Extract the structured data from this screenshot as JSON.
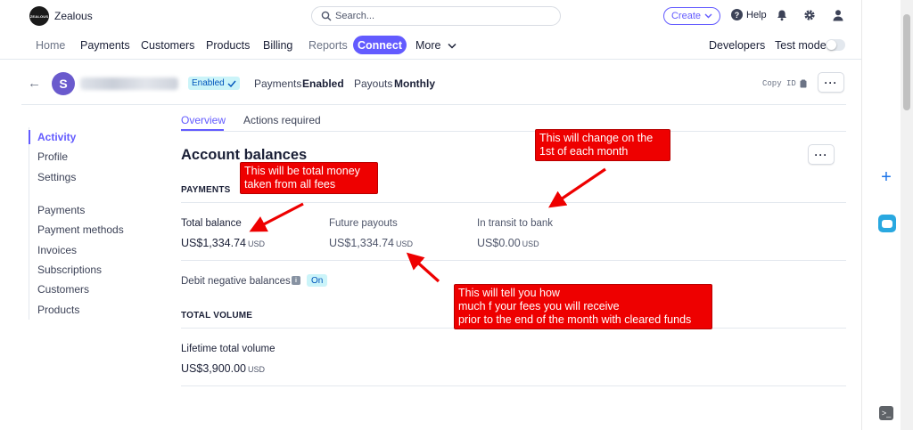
{
  "topbar": {
    "brand": "Zealous",
    "logo_text": "ZEALOUS",
    "search_placeholder": "Search...",
    "create_label": "Create",
    "help_label": "Help"
  },
  "nav": {
    "items": [
      "Home",
      "Payments",
      "Customers",
      "Products",
      "Billing",
      "Reports",
      "Connect",
      "More"
    ],
    "developers": "Developers",
    "test_mode": "Test mode"
  },
  "account_header": {
    "avatar_letter": "S",
    "status_badge": "Enabled",
    "payments_label": "Payments",
    "payments_value": "Enabled",
    "payouts_label": "Payouts",
    "payouts_value": "Monthly",
    "copy_id": "Copy ID"
  },
  "sidenav": {
    "group1": [
      "Activity",
      "Profile",
      "Settings"
    ],
    "group2": [
      "Payments",
      "Payment methods",
      "Invoices",
      "Subscriptions",
      "Customers",
      "Products"
    ]
  },
  "tabs": [
    "Overview",
    "Actions required"
  ],
  "balances": {
    "title": "Account balances",
    "payments_caption": "PAYMENTS",
    "total_balance_label": "Total balance",
    "total_balance_value": "US$1,334.74",
    "future_payouts_label": "Future payouts",
    "future_payouts_value": "US$1,334.74",
    "in_transit_label": "In transit to bank",
    "in_transit_value": "US$0.00",
    "currency": "USD",
    "debit_label": "Debit negative balances",
    "debit_status": "On",
    "total_volume_caption": "TOTAL VOLUME",
    "lifetime_label": "Lifetime total volume",
    "lifetime_value": "US$3,900.00"
  },
  "annotations": {
    "total_money": [
      "This will be total money",
      "taken from all fees"
    ],
    "monthly_change": [
      "This will change on the",
      "1st of each month"
    ],
    "fees_receive": [
      "This will tell you how",
      "much f your fees you will receive",
      "prior to the end of the month with cleared funds"
    ]
  },
  "colors": {
    "accent": "#635bff",
    "annotation_red": "#ee0000",
    "badge_bg": "#cbf4f9"
  }
}
